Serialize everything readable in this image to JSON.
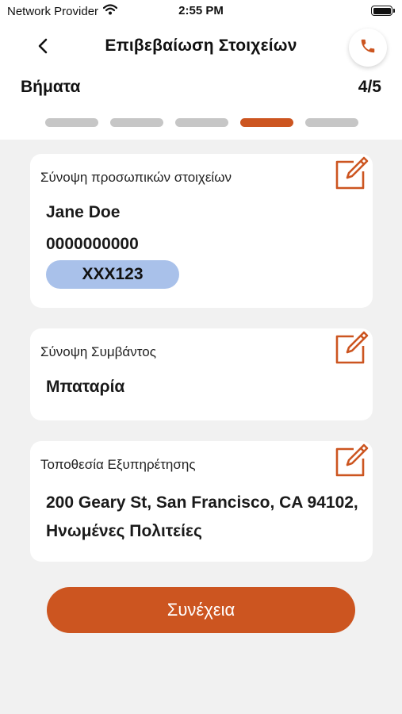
{
  "status_bar": {
    "carrier": "Network Provider",
    "time": "2:55 PM"
  },
  "header": {
    "title": "Επιβεβαίωση Στοιχείων"
  },
  "steps": {
    "label": "Βήματα",
    "counter": "4/5",
    "current": 4,
    "total": 5
  },
  "personal": {
    "label": "Σύνοψη προσωπικών στοιχείων",
    "name": "Jane Doe",
    "phone": "0000000000",
    "plate": "XXX123"
  },
  "incident": {
    "label": "Σύνοψη Συμβάντος",
    "value": "Μπαταρία"
  },
  "location": {
    "label": "Τοποθεσία Εξυπηρέτησης",
    "address": "200 Geary St, San Francisco, CA 94102, Ηνωμένες Πολιτείες"
  },
  "actions": {
    "continue_label": "Συνέχεια"
  },
  "colors": {
    "accent": "#cc5520",
    "plate_bg": "#a9c1ea",
    "background": "#f1f1f1"
  },
  "icons": {
    "back": "chevron-left-icon",
    "call": "phone-icon",
    "edit": "edit-icon",
    "wifi": "wifi-icon",
    "battery": "battery-icon"
  }
}
